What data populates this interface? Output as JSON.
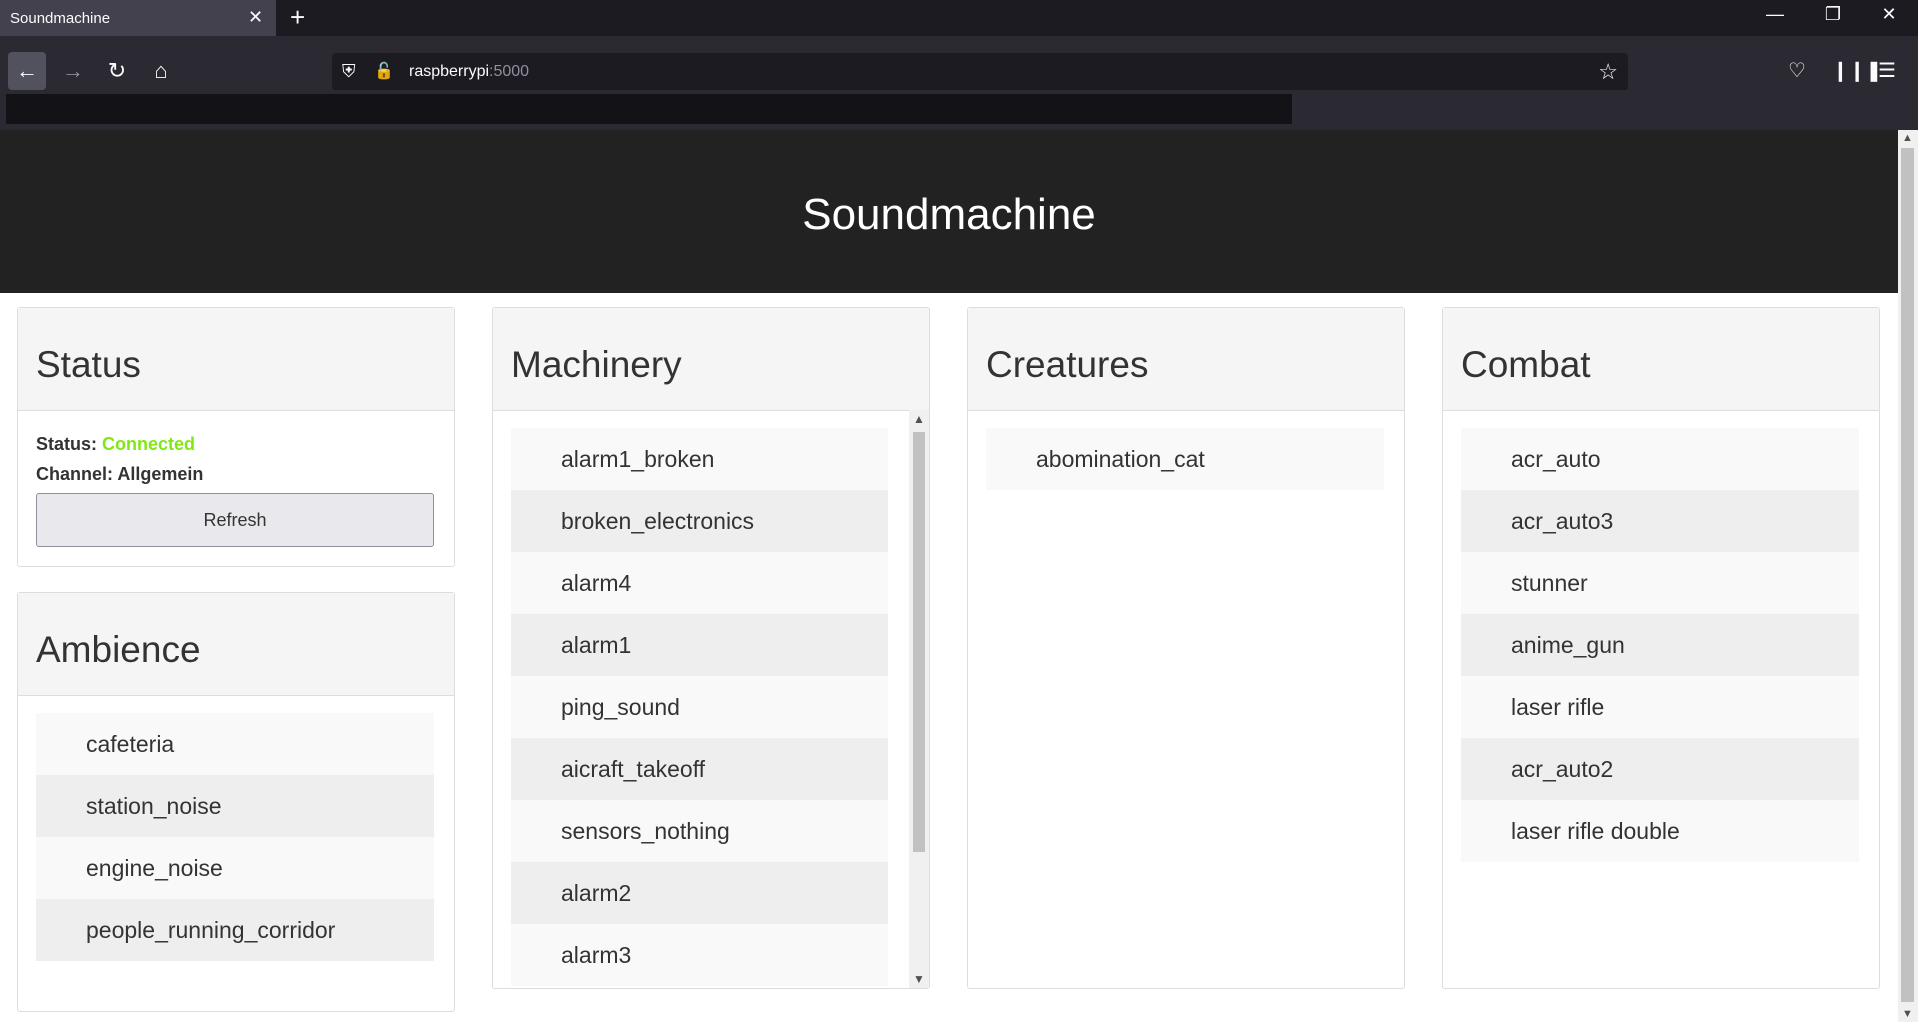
{
  "browser": {
    "tab_title": "Soundmachine",
    "tab_close": "✕",
    "new_tab": "+",
    "url_host": "raspberrypi",
    "url_port": ":5000",
    "icons": [
      "back-icon",
      "forward-icon",
      "reload-icon",
      "home-icon",
      "shield-icon",
      "lock-icon",
      "star-icon",
      "pocket-icon",
      "library-icon",
      "menu-icon",
      "minimize-icon",
      "restore-icon",
      "close-icon"
    ]
  },
  "page": {
    "title": "Soundmachine"
  },
  "status_panel": {
    "heading": "Status",
    "status_label": "Status:",
    "status_value": "Connected",
    "channel_label": "Channel:",
    "channel_value": "Allgemein",
    "refresh_label": "Refresh",
    "status_color": "#7fe817"
  },
  "ambience_panel": {
    "heading": "Ambience",
    "items": [
      "cafeteria",
      "station_noise",
      "engine_noise",
      "people_running_corridor"
    ]
  },
  "machinery_panel": {
    "heading": "Machinery",
    "items": [
      "alarm1_broken",
      "broken_electronics",
      "alarm4",
      "alarm1",
      "ping_sound",
      "aicraft_takeoff",
      "sensors_nothing",
      "alarm2",
      "alarm3"
    ]
  },
  "creatures_panel": {
    "heading": "Creatures",
    "items": [
      "abomination_cat"
    ]
  },
  "combat_panel": {
    "heading": "Combat",
    "items": [
      "acr_auto",
      "acr_auto3",
      "stunner",
      "anime_gun",
      "laser rifle",
      "acr_auto2",
      "laser rifle double"
    ]
  }
}
